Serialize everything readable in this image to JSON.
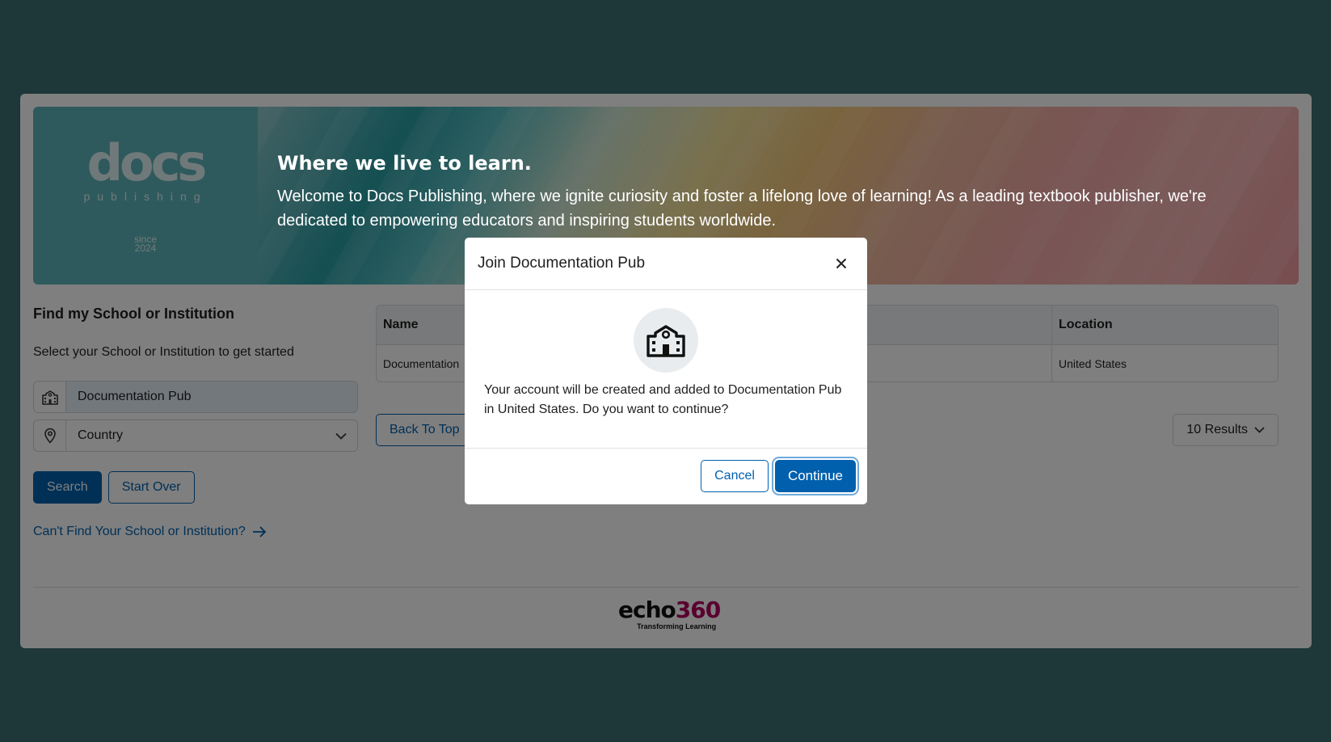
{
  "banner": {
    "logo_word": "docs",
    "logo_sub": "publishing",
    "logo_since_line1": "since",
    "logo_since_line2": "2024",
    "title": "Where we live to learn.",
    "text": "Welcome to Docs Publishing, where we ignite curiosity and foster a lifelong love of learning! As a leading textbook publisher, we're dedicated to empowering educators and inspiring students worldwide."
  },
  "search": {
    "title": "Find my School or Institution",
    "subtitle": "Select your School or Institution to get started",
    "school_value": "Documentation Pub",
    "country_value": "Country",
    "search_label": "Search",
    "start_over_label": "Start Over",
    "cant_find_label": "Can't Find Your School or Institution?"
  },
  "results": {
    "columns": [
      "Name",
      "Location"
    ],
    "rows": [
      {
        "name": "Documentation",
        "location": "United States"
      }
    ],
    "back_to_top_label": "Back To Top",
    "page_size_label": "10 Results"
  },
  "footer": {
    "brand_word": "echo",
    "brand_num": "360",
    "brand_tagline": "Transforming Learning"
  },
  "modal": {
    "title": "Join Documentation Pub",
    "message": "Your account will be created and added to Documentation Pub in United States. Do you want to continue?",
    "cancel_label": "Cancel",
    "continue_label": "Continue"
  },
  "colors": {
    "background": "#3c6e72",
    "primary": "#0060ad",
    "accent_logo": "#b3005e"
  }
}
